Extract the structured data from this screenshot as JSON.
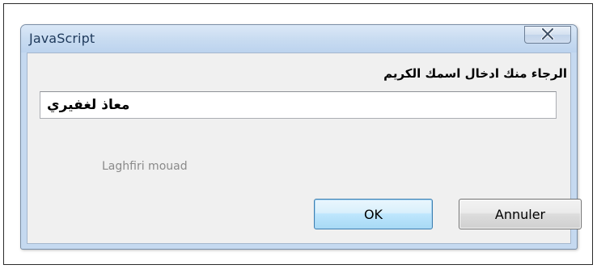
{
  "dialog": {
    "title": "JavaScript",
    "close_glyph": "X",
    "prompt": "الرجاء منك ادخال اسمك الكريم",
    "input_value": "معاذ لغفيري",
    "watermark": "Laghfiri mouad",
    "ok_label": "OK",
    "cancel_label": "Annuler"
  },
  "icons": {
    "close": "close-icon"
  },
  "colors": {
    "titlebar": "#c9dcf1",
    "title_text": "#1e395b",
    "content_bg": "#f0f0f0",
    "ok_button_border": "#3c7fb1",
    "watermark_text": "#8a8a8a"
  }
}
